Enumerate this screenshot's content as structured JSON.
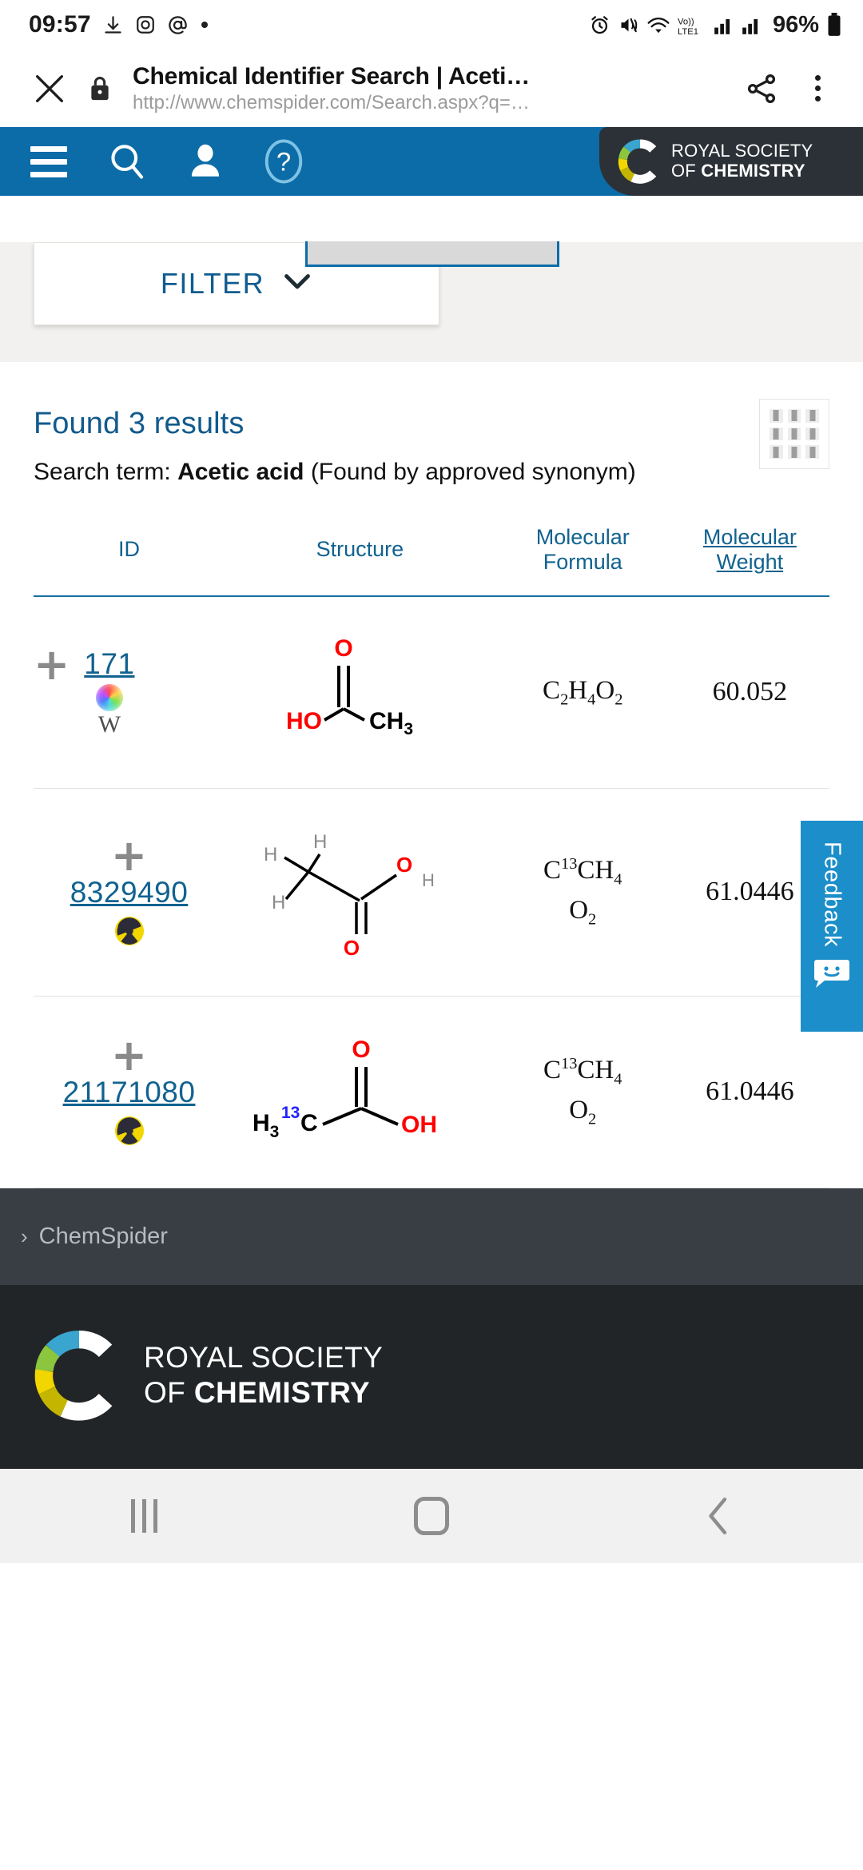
{
  "statusbar": {
    "time": "09:57",
    "icons": [
      "download-icon",
      "camera-icon",
      "at-icon",
      "dot-icon"
    ],
    "right_icons": [
      "alarm-icon",
      "mute-icon",
      "wifi-icon",
      "volte-icon",
      "signal-icon",
      "signal-icon-2"
    ],
    "battery": "96%"
  },
  "browser": {
    "close_label": "×",
    "lock_icon": "lock-icon",
    "title": "Chemical Identifier Search | Aceti…",
    "url": "http://www.chemspider.com/Search.aspx?q=…",
    "share_icon": "share-icon",
    "menu_icon": "more-vertical-icon"
  },
  "siteheader": {
    "menu_icon": "hamburger-icon",
    "search_icon": "search-icon",
    "account_icon": "user-icon",
    "help_icon": "help-icon",
    "logo_line1": "ROYAL SOCIETY",
    "logo_line2_light": "OF ",
    "logo_line2_bold": "CHEMISTRY",
    "background": "#0c6ca8"
  },
  "filter": {
    "label": "FILTER",
    "chevron": "chevron-down-icon"
  },
  "results": {
    "found_heading": "Found 3 results",
    "search_term_prefix": "Search term: ",
    "search_term_value": "Acetic acid",
    "search_term_suffix": " (Found by approved synonym)",
    "grid_toggle_icon": "grid-view-icon",
    "columns": [
      {
        "label": "ID",
        "sorted": false
      },
      {
        "label": "Structure",
        "sorted": false
      },
      {
        "label_line1": "Molecular",
        "label_line2": "Formula",
        "sorted": false
      },
      {
        "label_line1": "Molecular",
        "label_line2": "Weight",
        "sorted": true
      }
    ],
    "rows": [
      {
        "expand_icon": "plus-icon",
        "id": "171",
        "badges": [
          "color-wheel-icon",
          "wikipedia-icon"
        ],
        "structure_alt": "HO-C(=O)-CH3",
        "structure_labels": {
          "left": "HO",
          "top": "O",
          "right": "CH",
          "right_sub": "3"
        },
        "formula_html": "C<sub>2</sub>H<sub>4</sub>O<sub>2</sub>",
        "formula_text": "C2H4O2",
        "weight": "60.052"
      },
      {
        "expand_icon": "plus-icon",
        "id": "8329490",
        "badges": [
          "radioactive-icon"
        ],
        "structure_alt": "H3C-C(=O)-O-H explicit hydrogens",
        "structure_labels": {
          "h1": "H",
          "h2": "H",
          "h3": "H",
          "o_top": "O",
          "o_bottom": "O",
          "h_oh": "H"
        },
        "formula_html": "C<sup>13</sup>CH<sub>4</sub><br>O<sub>2</sub>",
        "formula_text": "C13CH4O2",
        "weight": "61.0446"
      },
      {
        "expand_icon": "plus-icon",
        "id": "21171080",
        "badges": [
          "radioactive-icon"
        ],
        "structure_alt": "H3 13C-C(=O)-OH",
        "structure_labels": {
          "left": "H",
          "left_sub": "3",
          "iso": "13",
          "c": "C",
          "top": "O",
          "right": "OH"
        },
        "formula_html": "C<sup>13</sup>CH<sub>4</sub><br>O<sub>2</sub>",
        "formula_text": "C13CH4O2",
        "weight": "61.0446"
      }
    ]
  },
  "feedback": {
    "label": "Feedback",
    "icon": "smiley-chat-icon",
    "color": "#1c8ec9"
  },
  "footer": {
    "links": [
      {
        "caret": "›",
        "label": "ChemSpider"
      }
    ],
    "brand_line1": "ROYAL SOCIETY",
    "brand_line2_light": "OF ",
    "brand_line2_bold": "CHEMISTRY"
  },
  "androidnav": {
    "recents_icon": "recents-icon",
    "home_icon": "home-icon",
    "back_icon": "back-icon"
  }
}
